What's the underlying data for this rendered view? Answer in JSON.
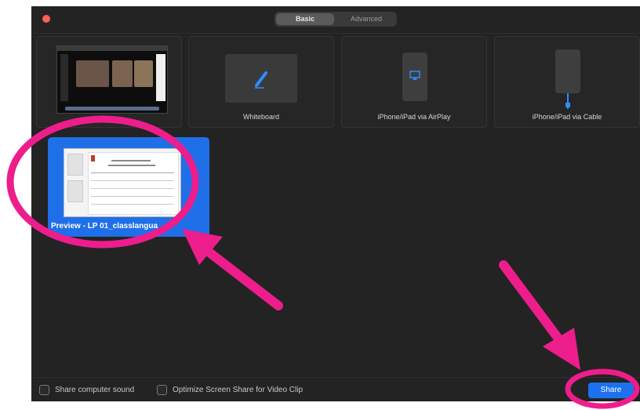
{
  "tabs": {
    "basic": "Basic",
    "advanced": "Advanced"
  },
  "sources": [
    {
      "label": ""
    },
    {
      "label": "Whiteboard"
    },
    {
      "label": "iPhone/iPad via AirPlay"
    },
    {
      "label": "iPhone/iPad via Cable"
    }
  ],
  "selected_window": {
    "label": "Preview - LP 01_classlangua"
  },
  "footer": {
    "share_sound": "Share computer sound",
    "optimize": "Optimize Screen Share for Video Clip",
    "share_button": "Share"
  },
  "colors": {
    "accent": "#1f6fe8",
    "annotation": "#ee1d8c",
    "window_bg": "#232323"
  }
}
